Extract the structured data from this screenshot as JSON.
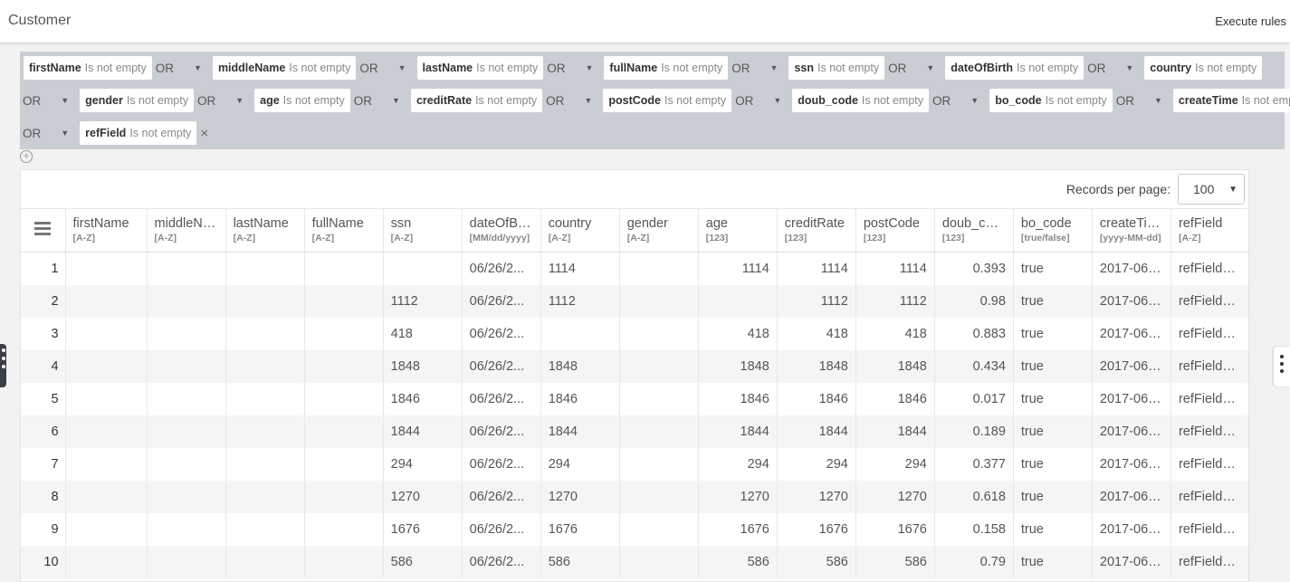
{
  "header": {
    "title": "Customer",
    "execute_label": "Execute rules"
  },
  "filters": {
    "not_empty_text": "Is not empty",
    "or_label": "OR",
    "rows": [
      {
        "lead_or": false,
        "items": [
          "firstName",
          "middleName",
          "lastName",
          "fullName",
          "ssn",
          "dateOfBirth",
          "country"
        ],
        "trailing_or": false
      },
      {
        "lead_or": true,
        "items": [
          "gender",
          "age",
          "creditRate",
          "postCode",
          "doub_code",
          "bo_code",
          "createTime"
        ],
        "trailing_or": false
      },
      {
        "lead_or": true,
        "items": [
          "refField"
        ],
        "remove": "×"
      }
    ]
  },
  "pagination": {
    "records_label": "Records per page:",
    "value": "100"
  },
  "table": {
    "columns": [
      {
        "name": "firstName",
        "type": "[A-Z]",
        "num": false
      },
      {
        "name": "middleName",
        "type": "[A-Z]",
        "num": false
      },
      {
        "name": "lastName",
        "type": "[A-Z]",
        "num": false
      },
      {
        "name": "fullName",
        "type": "[A-Z]",
        "num": false
      },
      {
        "name": "ssn",
        "type": "[A-Z]",
        "num": false
      },
      {
        "name": "dateOfBirth",
        "type": "[MM/dd/yyyy]",
        "num": false
      },
      {
        "name": "country",
        "type": "[A-Z]",
        "num": false
      },
      {
        "name": "gender",
        "type": "[A-Z]",
        "num": false
      },
      {
        "name": "age",
        "type": "[123]",
        "num": true
      },
      {
        "name": "creditRate",
        "type": "[123]",
        "num": true
      },
      {
        "name": "postCode",
        "type": "[123]",
        "num": true
      },
      {
        "name": "doub_code",
        "type": "[123]",
        "num": true
      },
      {
        "name": "bo_code",
        "type": "[true/false]",
        "num": false
      },
      {
        "name": "createTime",
        "type": "[yyyy-MM-dd]",
        "num": false
      },
      {
        "name": "refField",
        "type": "[A-Z]",
        "num": false
      }
    ],
    "rows": [
      [
        "1",
        "",
        "",
        "",
        "",
        "",
        "06/26/2...",
        "1114",
        "",
        "1114",
        "1114",
        "1114",
        "0.393",
        "true",
        "2017-06-...",
        "refFieldC..."
      ],
      [
        "2",
        "",
        "",
        "",
        "",
        "1112",
        "06/26/2...",
        "1112",
        "",
        "",
        "1112",
        "1112",
        "0.98",
        "true",
        "2017-06-...",
        "refFieldC..."
      ],
      [
        "3",
        "",
        "",
        "",
        "",
        "418",
        "06/26/2...",
        "",
        "",
        "418",
        "418",
        "418",
        "0.883",
        "true",
        "2017-06-...",
        "refFieldC..."
      ],
      [
        "4",
        "",
        "",
        "",
        "",
        "1848",
        "06/26/2...",
        "1848",
        "",
        "1848",
        "1848",
        "1848",
        "0.434",
        "true",
        "2017-06-...",
        "refFieldC..."
      ],
      [
        "5",
        "",
        "",
        "",
        "",
        "1846",
        "06/26/2...",
        "1846",
        "",
        "1846",
        "1846",
        "1846",
        "0.017",
        "true",
        "2017-06-...",
        "refFieldC..."
      ],
      [
        "6",
        "",
        "",
        "",
        "",
        "1844",
        "06/26/2...",
        "1844",
        "",
        "1844",
        "1844",
        "1844",
        "0.189",
        "true",
        "2017-06-...",
        "refFieldC..."
      ],
      [
        "7",
        "",
        "",
        "",
        "",
        "294",
        "06/26/2...",
        "294",
        "",
        "294",
        "294",
        "294",
        "0.377",
        "true",
        "2017-06-...",
        "refFieldC..."
      ],
      [
        "8",
        "",
        "",
        "",
        "",
        "1270",
        "06/26/2...",
        "1270",
        "",
        "1270",
        "1270",
        "1270",
        "0.618",
        "true",
        "2017-06-...",
        "refFieldC..."
      ],
      [
        "9",
        "",
        "",
        "",
        "",
        "1676",
        "06/26/2...",
        "1676",
        "",
        "1676",
        "1676",
        "1676",
        "0.158",
        "true",
        "2017-06-...",
        "refFieldC..."
      ],
      [
        "10",
        "",
        "",
        "",
        "",
        "586",
        "06/26/2...",
        "586",
        "",
        "586",
        "586",
        "586",
        "0.79",
        "true",
        "2017-06-...",
        "refFieldC..."
      ]
    ]
  }
}
